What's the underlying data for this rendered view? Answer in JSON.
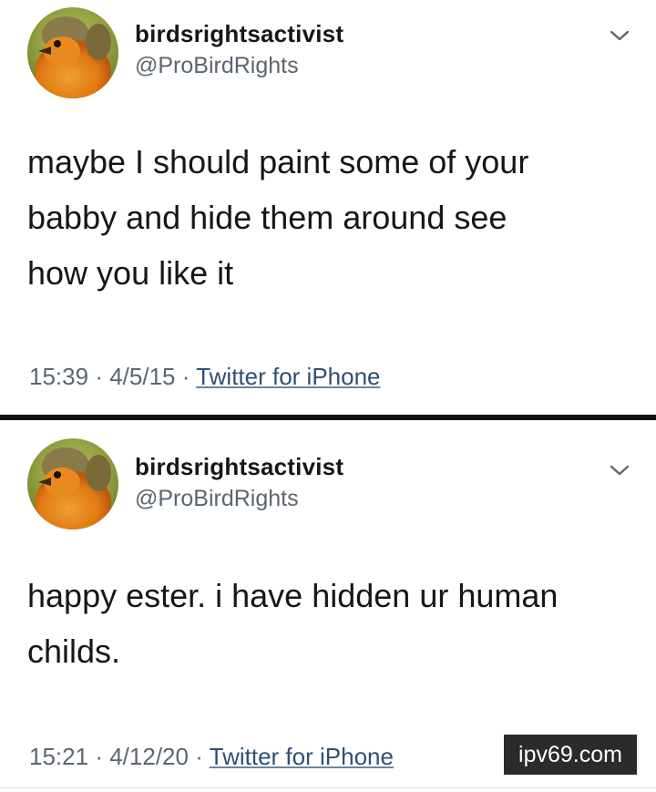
{
  "tweets": [
    {
      "display_name": "birdsrightsactivist",
      "handle": "@ProBirdRights",
      "text_lines": [
        "maybe I should paint some of your",
        "babby and hide them around see",
        "how you like it"
      ],
      "time": "15:39",
      "date": "4/5/15",
      "source": "Twitter for iPhone",
      "separator": "·"
    },
    {
      "display_name": "birdsrightsactivist",
      "handle": "@ProBirdRights",
      "text_lines": [
        "happy ester. i have hidden ur human",
        "childs."
      ],
      "time": "15:21",
      "date": "4/12/20",
      "source": "Twitter for iPhone",
      "separator": "·"
    }
  ],
  "watermark": "ipv69.com",
  "icons": {
    "avatar": "robin-bird-avatar",
    "menu": "chevron-down-icon"
  },
  "colors": {
    "text": "#14171a",
    "secondary": "#5b6670",
    "link": "#2f4f73",
    "divider": "#111111",
    "watermark_bg": "#2b2b2b"
  }
}
